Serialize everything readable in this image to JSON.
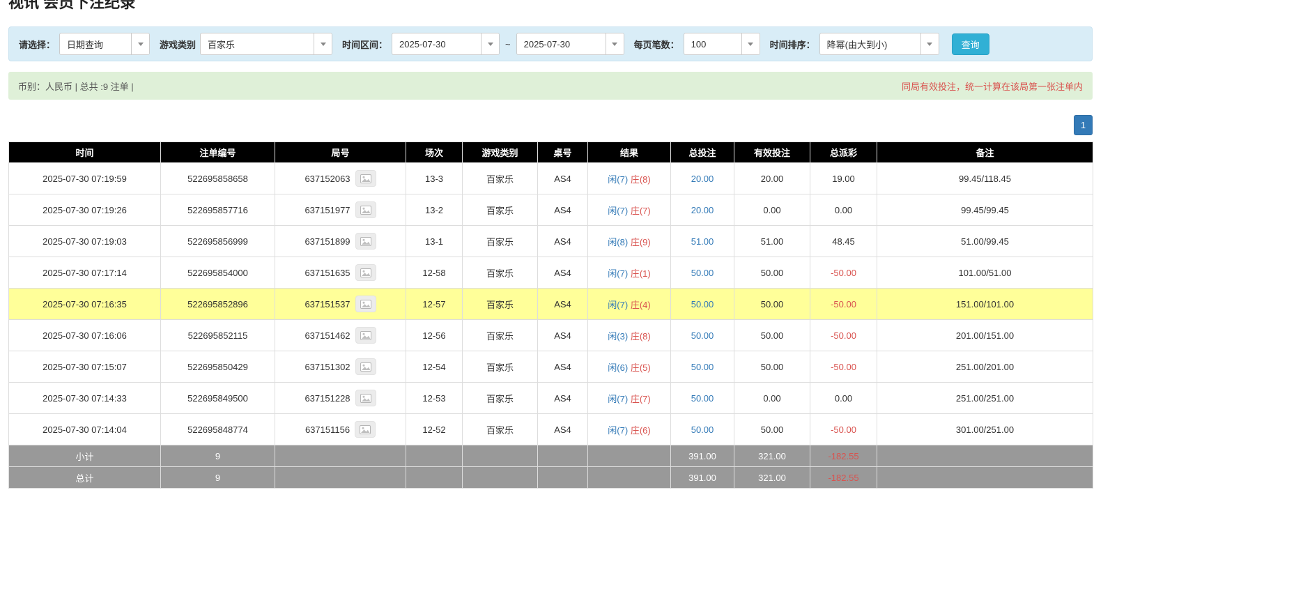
{
  "page": {
    "title": "视讯 会员下注纪录"
  },
  "colors": {
    "filter_bar_bg": "#d9edf7",
    "info_bar_bg": "#dff0d8",
    "accent_blue": "#337ab7",
    "query_button": "#31b0d5",
    "highlight_row": "#ffff99",
    "summary_row_bg": "#999999",
    "table_header_bg": "#000000",
    "negative_red": "#d9534f",
    "player_blue": "#337ab7",
    "banker_red": "#d9534f"
  },
  "icons": {
    "round_action": "video-replay-icon",
    "select_caret": "chevron-down-icon"
  },
  "filters": {
    "select_label": "请选择：",
    "select_value": "日期查询",
    "game_label": "游戏类别",
    "game_value": "百家乐",
    "range_label": "时间区间：",
    "date_from": "2025-07-30",
    "range_sep": "~",
    "date_to": "2025-07-30",
    "per_page_label": "每页笔数：",
    "per_page_value": "100",
    "sort_label": "时间排序：",
    "sort_value": "降幂(由大到小)",
    "query_button": "查询"
  },
  "info_bar": {
    "left": "币别：人民币 | 总共 :9 注单 |",
    "right": "同局有效投注，统一计算在该局第一张注单内"
  },
  "pagination": {
    "current_page": "1"
  },
  "table": {
    "headers": [
      "时间",
      "注单编号",
      "局号",
      "场次",
      "游戏类别",
      "桌号",
      "结果",
      "总投注",
      "有效投注",
      "总派彩",
      "备注"
    ],
    "rows": [
      {
        "time": "2025-07-30 07:19:59",
        "bet_id": "522695858658",
        "round_id": "637152063",
        "session": "13-3",
        "game": "百家乐",
        "table_no": "AS4",
        "result_player": "闲(7)",
        "result_banker": "庄(8)",
        "total_bet": "20.00",
        "valid_bet": "20.00",
        "payout": "19.00",
        "payout_negative": false,
        "remark": "99.45/118.45",
        "highlight": false
      },
      {
        "time": "2025-07-30 07:19:26",
        "bet_id": "522695857716",
        "round_id": "637151977",
        "session": "13-2",
        "game": "百家乐",
        "table_no": "AS4",
        "result_player": "闲(7)",
        "result_banker": "庄(7)",
        "total_bet": "20.00",
        "valid_bet": "0.00",
        "payout": "0.00",
        "payout_negative": false,
        "remark": "99.45/99.45",
        "highlight": false
      },
      {
        "time": "2025-07-30 07:19:03",
        "bet_id": "522695856999",
        "round_id": "637151899",
        "session": "13-1",
        "game": "百家乐",
        "table_no": "AS4",
        "result_player": "闲(8)",
        "result_banker": "庄(9)",
        "total_bet": "51.00",
        "valid_bet": "51.00",
        "payout": "48.45",
        "payout_negative": false,
        "remark": "51.00/99.45",
        "highlight": false
      },
      {
        "time": "2025-07-30 07:17:14",
        "bet_id": "522695854000",
        "round_id": "637151635",
        "session": "12-58",
        "game": "百家乐",
        "table_no": "AS4",
        "result_player": "闲(7)",
        "result_banker": "庄(1)",
        "total_bet": "50.00",
        "valid_bet": "50.00",
        "payout": "-50.00",
        "payout_negative": true,
        "remark": "101.00/51.00",
        "highlight": false
      },
      {
        "time": "2025-07-30 07:16:35",
        "bet_id": "522695852896",
        "round_id": "637151537",
        "session": "12-57",
        "game": "百家乐",
        "table_no": "AS4",
        "result_player": "闲(7)",
        "result_banker": "庄(4)",
        "total_bet": "50.00",
        "valid_bet": "50.00",
        "payout": "-50.00",
        "payout_negative": true,
        "remark": "151.00/101.00",
        "highlight": true
      },
      {
        "time": "2025-07-30 07:16:06",
        "bet_id": "522695852115",
        "round_id": "637151462",
        "session": "12-56",
        "game": "百家乐",
        "table_no": "AS4",
        "result_player": "闲(3)",
        "result_banker": "庄(8)",
        "total_bet": "50.00",
        "valid_bet": "50.00",
        "payout": "-50.00",
        "payout_negative": true,
        "remark": "201.00/151.00",
        "highlight": false
      },
      {
        "time": "2025-07-30 07:15:07",
        "bet_id": "522695850429",
        "round_id": "637151302",
        "session": "12-54",
        "game": "百家乐",
        "table_no": "AS4",
        "result_player": "闲(6)",
        "result_banker": "庄(5)",
        "total_bet": "50.00",
        "valid_bet": "50.00",
        "payout": "-50.00",
        "payout_negative": true,
        "remark": "251.00/201.00",
        "highlight": false
      },
      {
        "time": "2025-07-30 07:14:33",
        "bet_id": "522695849500",
        "round_id": "637151228",
        "session": "12-53",
        "game": "百家乐",
        "table_no": "AS4",
        "result_player": "闲(7)",
        "result_banker": "庄(7)",
        "total_bet": "50.00",
        "valid_bet": "0.00",
        "payout": "0.00",
        "payout_negative": false,
        "remark": "251.00/251.00",
        "highlight": false
      },
      {
        "time": "2025-07-30 07:14:04",
        "bet_id": "522695848774",
        "round_id": "637151156",
        "session": "12-52",
        "game": "百家乐",
        "table_no": "AS4",
        "result_player": "闲(7)",
        "result_banker": "庄(6)",
        "total_bet": "50.00",
        "valid_bet": "50.00",
        "payout": "-50.00",
        "payout_negative": true,
        "remark": "301.00/251.00",
        "highlight": false
      }
    ],
    "subtotal": {
      "label": "小计",
      "count": "9",
      "total_bet": "391.00",
      "valid_bet": "321.00",
      "payout": "-182.55"
    },
    "total": {
      "label": "总计",
      "count": "9",
      "total_bet": "391.00",
      "valid_bet": "321.00",
      "payout": "-182.55"
    }
  }
}
